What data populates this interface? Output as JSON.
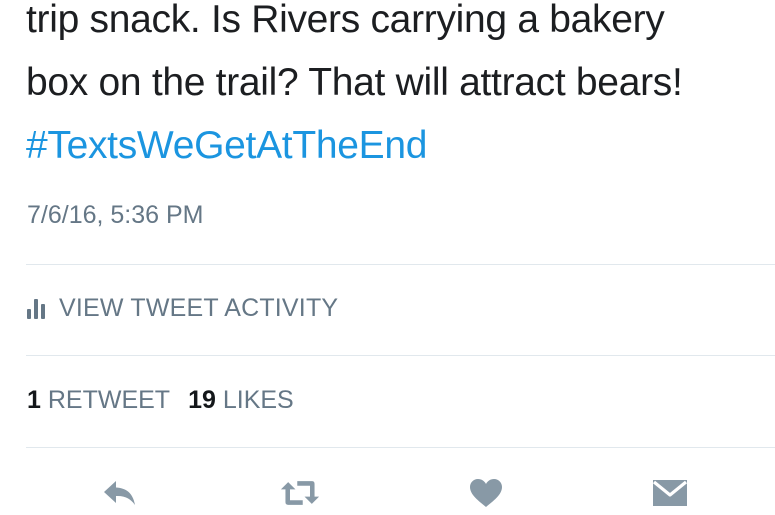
{
  "tweet": {
    "text_lines": [
      "trip snack. Is Rivers carrying a bakery",
      "box on the trail? That will attract bears!"
    ],
    "hashtag": "#TextsWeGetAtTheEnd",
    "timestamp": "7/6/16, 5:36 PM"
  },
  "activity": {
    "label": "VIEW TWEET ACTIVITY",
    "icon": "bar-chart-icon"
  },
  "stats": {
    "retweets_count": "1",
    "retweets_label": "RETWEET",
    "likes_count": "19",
    "likes_label": "LIKES"
  },
  "actions": [
    {
      "name": "reply",
      "icon": "reply-icon"
    },
    {
      "name": "retweet",
      "icon": "retweet-icon"
    },
    {
      "name": "like",
      "icon": "heart-icon"
    },
    {
      "name": "message",
      "icon": "envelope-icon"
    }
  ],
  "colors": {
    "link": "#1b95e0",
    "muted": "#657786",
    "icon": "#8899a6",
    "divider": "#e1e8ed"
  }
}
